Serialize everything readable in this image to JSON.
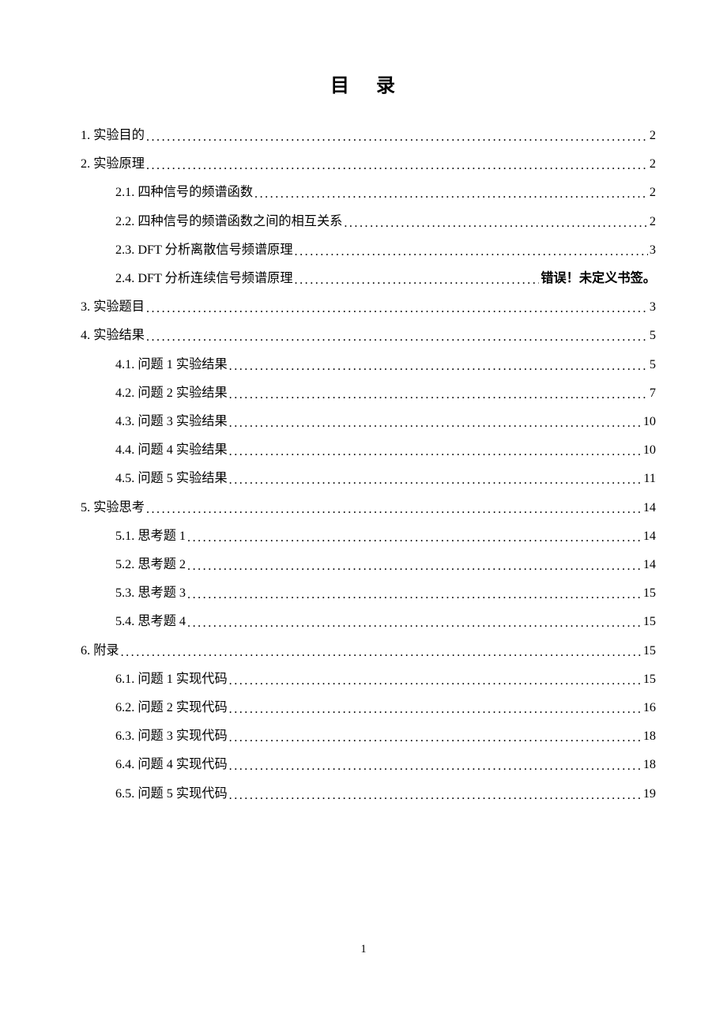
{
  "title": "目 录",
  "page_number": "1",
  "error_bookmark": "错误！未定义书签。",
  "toc": [
    {
      "level": 1,
      "label": "1.  实验目的",
      "page": "2"
    },
    {
      "level": 1,
      "label": "2.  实验原理",
      "page": "2"
    },
    {
      "level": 2,
      "label": "2.1.  四种信号的频谱函数",
      "page": "2"
    },
    {
      "level": 2,
      "label": "2.2.  四种信号的频谱函数之间的相互关系",
      "page": "2"
    },
    {
      "level": 2,
      "label": "2.3. DFT 分析离散信号频谱原理",
      "page": "3"
    },
    {
      "level": 2,
      "label": "2.4. DFT 分析连续信号频谱原理",
      "page": null,
      "error": true
    },
    {
      "level": 1,
      "label": "3.  实验题目",
      "page": "3"
    },
    {
      "level": 1,
      "label": "4.  实验结果",
      "page": "5"
    },
    {
      "level": 2,
      "label": "4.1.  问题 1 实验结果",
      "page": "5"
    },
    {
      "level": 2,
      "label": "4.2.  问题 2 实验结果",
      "page": "7"
    },
    {
      "level": 2,
      "label": "4.3.  问题 3 实验结果",
      "page": "10"
    },
    {
      "level": 2,
      "label": "4.4.  问题 4 实验结果",
      "page": "10"
    },
    {
      "level": 2,
      "label": "4.5.  问题 5 实验结果",
      "page": "11"
    },
    {
      "level": 1,
      "label": "5.  实验思考",
      "page": "14"
    },
    {
      "level": 2,
      "label": "5.1.  思考题 1",
      "page": "14"
    },
    {
      "level": 2,
      "label": "5.2.  思考题 2",
      "page": "14"
    },
    {
      "level": 2,
      "label": "5.3.  思考题 3",
      "page": "15"
    },
    {
      "level": 2,
      "label": "5.4.  思考题 4",
      "page": "15"
    },
    {
      "level": 1,
      "label": "6.  附录",
      "page": "15"
    },
    {
      "level": 2,
      "label": "6.1.  问题 1 实现代码",
      "page": "15"
    },
    {
      "level": 2,
      "label": "6.2.  问题 2 实现代码",
      "page": "16"
    },
    {
      "level": 2,
      "label": "6.3.  问题 3 实现代码",
      "page": "18"
    },
    {
      "level": 2,
      "label": "6.4.  问题 4 实现代码",
      "page": "18"
    },
    {
      "level": 2,
      "label": "6.5.  问题 5 实现代码",
      "page": "19"
    }
  ]
}
